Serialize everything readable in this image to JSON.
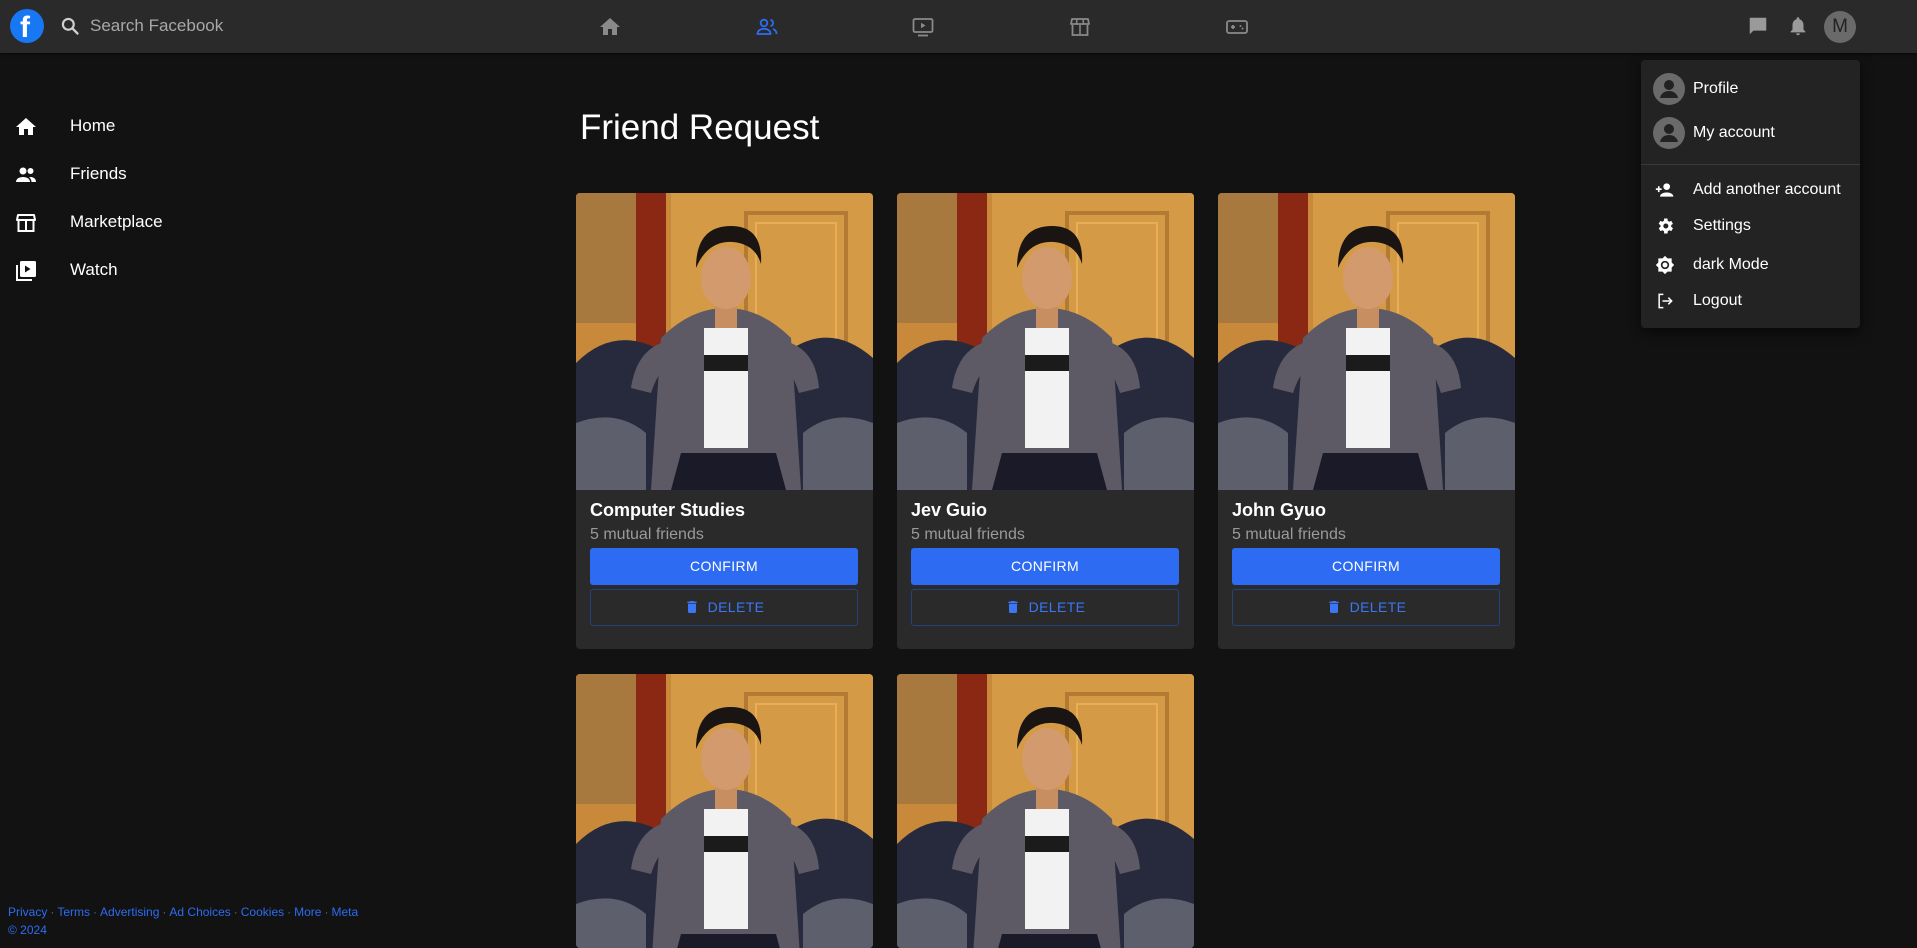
{
  "colors": {
    "accent": "#2d6cf2",
    "background": "#121212",
    "card": "#2a2a2a",
    "topbar": "#2a2a2a"
  },
  "topbar": {
    "logo_letter": "f",
    "search_placeholder": "Search Facebook",
    "nav_icons": [
      "home-icon",
      "friends-icon",
      "watch-icon",
      "marketplace-icon",
      "gaming-icon"
    ],
    "active_nav": "friends-icon",
    "right_icons": [
      "messenger-icon",
      "notifications-icon"
    ],
    "avatar_letter": "M"
  },
  "sidebar": {
    "items": [
      {
        "label": "Home",
        "icon": "home-icon"
      },
      {
        "label": "Friends",
        "icon": "friends-icon"
      },
      {
        "label": "Marketplace",
        "icon": "marketplace-icon"
      },
      {
        "label": "Watch",
        "icon": "watch-icon"
      }
    ],
    "footer_links": [
      "Privacy",
      "Terms",
      "Advertising",
      "Ad Choices",
      "Cookies",
      "More",
      "Meta"
    ],
    "copyright": "© 2024"
  },
  "main": {
    "title": "Friend Request",
    "confirm_label": "CONFIRM",
    "delete_label": "DELETE",
    "requests": [
      {
        "name": "Computer Studies",
        "mutual": "5 mutual friends"
      },
      {
        "name": "Jev Guio",
        "mutual": "5 mutual friends"
      },
      {
        "name": "John Gyuo",
        "mutual": "5 mutual friends"
      },
      {
        "name": "",
        "mutual": ""
      },
      {
        "name": "",
        "mutual": ""
      }
    ]
  },
  "account_menu": {
    "items": [
      {
        "label": "Profile",
        "icon": "account-circle-icon"
      },
      {
        "label": "My account",
        "icon": "account-circle-icon"
      },
      {
        "label": "Add another account",
        "icon": "person-add-icon"
      },
      {
        "label": "Settings",
        "icon": "settings-icon"
      },
      {
        "label": "dark Mode",
        "icon": "brightness-icon"
      },
      {
        "label": "Logout",
        "icon": "logout-icon"
      }
    ]
  }
}
